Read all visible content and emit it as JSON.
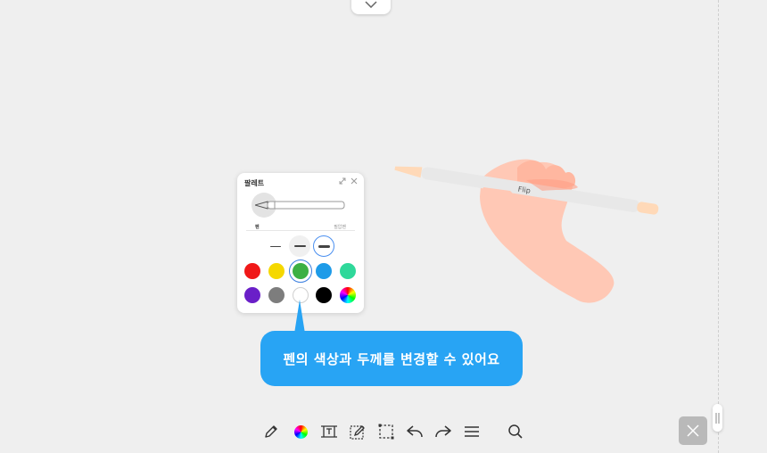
{
  "palette": {
    "title": "팔레트",
    "pen_label": "펜",
    "pressure_label": "필압펜",
    "thicknesses": [
      "thin",
      "medium",
      "thick"
    ],
    "selected_thickness": "thick",
    "colors": [
      "#f01818",
      "#f5d800",
      "#3cb043",
      "#1e9be8",
      "#2fd89a",
      "#6a1fc8",
      "#7d7d7d",
      "#ffffff",
      "#000000",
      "rainbow"
    ],
    "selected_color": "#3cb043"
  },
  "illustration": {
    "pen_brand": "Flip"
  },
  "tooltip": {
    "text": "펜의 색상과 두께를 변경할 수 있어요"
  },
  "toolbar": {
    "tools": [
      "pen-icon",
      "color-icon",
      "text-box-icon",
      "edit-box-icon",
      "select-icon",
      "undo-icon",
      "redo-icon",
      "menu-icon",
      "search-icon"
    ]
  },
  "colors": {
    "accent": "#28a4f4",
    "background": "#efefef"
  }
}
